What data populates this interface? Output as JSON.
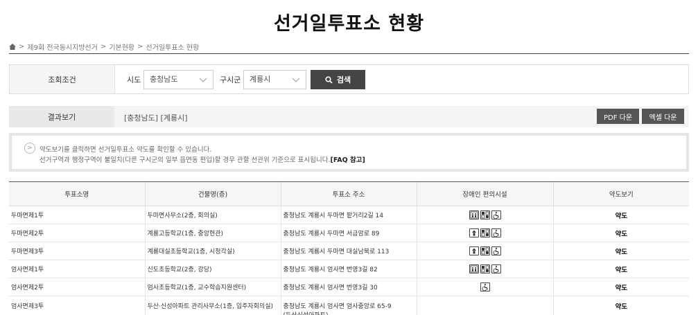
{
  "page": {
    "title": "선거일투표소 현황"
  },
  "breadcrumb": {
    "items": [
      "제9회 전국동시지방선거",
      "기본현황",
      "선거일투표소 현황"
    ],
    "separator": ">"
  },
  "search": {
    "label": "조회조건",
    "sido_label": "시도",
    "sido_value": "충청남도",
    "sigungu_label": "구시군",
    "sigungu_value": "계룡시",
    "button_label": "검색"
  },
  "result": {
    "label": "결과보기",
    "region_text": "[충청남도] [계룡시]",
    "pdf_button": "PDF 다운",
    "excel_button": "엑셀 다운"
  },
  "notice": {
    "line1": "약도보기를 클릭하면 선거일투표소 약도를 확인할 수 있습니다.",
    "line2": "선거구역과 행정구역이 불일치(다른 구시군의 일부 읍면동 편입)할 경우 관할 선관위 기준으로 표시됩니다.",
    "faq": "[FAQ 참고]"
  },
  "table": {
    "headers": [
      "투표소명",
      "건물명(층)",
      "투표소 주소",
      "장애인 편의시설",
      "약도보기"
    ],
    "rows": [
      {
        "name": "두마면제1투",
        "building": "두마면사무소(2층, 회의실)",
        "address": "충청남도 계룡시 두마면 팥거리2길 14",
        "address2": "",
        "facilities": [
          "elevator",
          "braille",
          "wheelchair"
        ],
        "map": "약도"
      },
      {
        "name": "두마면제2투",
        "building": "계룡고등학교(1층, 중앙현관)",
        "address": "충청남도 계룡시 두마면 서금암로 89",
        "address2": "",
        "facilities": [
          "lift",
          "braille",
          "wheelchair"
        ],
        "map": "약도"
      },
      {
        "name": "두마면제3투",
        "building": "계룡대실초등학교(1층, 시청각실)",
        "address": "충청남도 계룡시 두마면 대실남북로 113",
        "address2": "",
        "facilities": [
          "lift",
          "braille",
          "wheelchair"
        ],
        "map": "약도"
      },
      {
        "name": "엄사면제1투",
        "building": "신도초등학교(2층, 강당)",
        "address": "충청남도 계룡시 엄사면 번영3길 82",
        "address2": "",
        "facilities": [
          "elevator",
          "braille",
          "wheelchair"
        ],
        "map": "약도"
      },
      {
        "name": "엄사면제2투",
        "building": "엄사초등학교(1층, 교수학습지원센터)",
        "address": "충청남도 계룡시 엄사면 번영3길 30",
        "address2": "",
        "facilities": [
          "wheelchair"
        ],
        "map": "약도"
      },
      {
        "name": "엄사면제3투",
        "building": "두산·신성아파트 관리사무소(1층, 입주자회의실)",
        "address": "충청남도 계룡시 엄사면 엄사중앙로 65-9",
        "address2": "(두산신성아파트)",
        "facilities": [],
        "map": "약도"
      }
    ]
  },
  "colors": {
    "dark_button": "#444444",
    "gray_button": "#555555",
    "label_bg": "#f5f5f5"
  }
}
